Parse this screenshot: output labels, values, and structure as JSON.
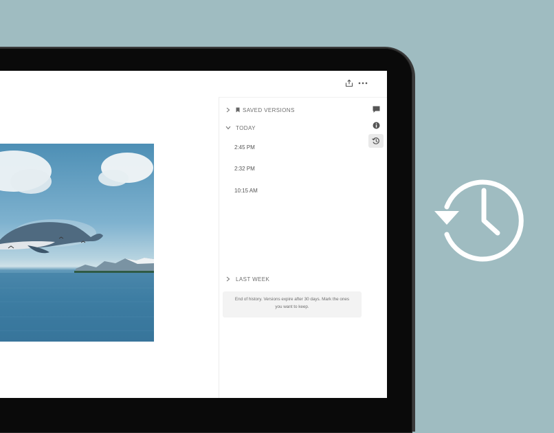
{
  "history_panel": {
    "saved_versions_label": "SAVED VERSIONS",
    "today_label": "TODAY",
    "today_versions": [
      "2:45 PM",
      "2:32 PM",
      "10:15 AM"
    ],
    "last_week_label": "LAST WEEK",
    "notice": "End of history. Versions expire after 30 days. Mark the ones you want to keep."
  },
  "toolbar": {
    "share_icon": "share-icon",
    "more_icon": "more-options-icon"
  },
  "rail": {
    "comments_icon": "comment-icon",
    "info_icon": "info-icon",
    "history_icon": "history-icon",
    "active": "history"
  },
  "colors": {
    "background": "#9fbcc1",
    "device": "#0a0a0a",
    "screen": "#ffffff"
  }
}
